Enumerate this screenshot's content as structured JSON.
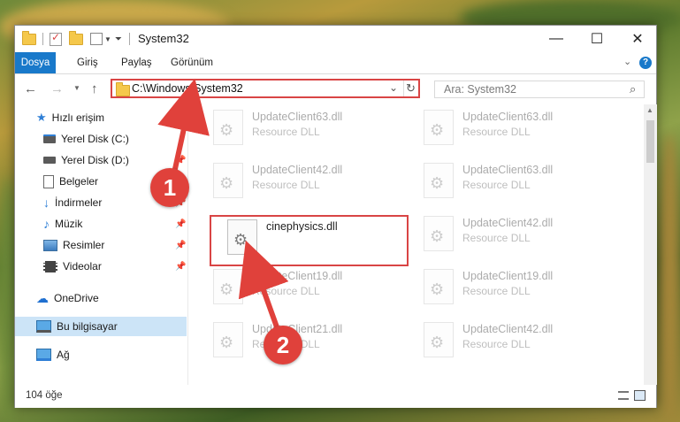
{
  "window": {
    "title": "System32",
    "controls": {
      "minimize": "—",
      "maximize": "☐",
      "close": "✕"
    }
  },
  "ribbon": {
    "tabs": [
      "Dosya",
      "Giriş",
      "Paylaş",
      "Görünüm"
    ],
    "active_tab": "Dosya"
  },
  "address": {
    "path": "C:\\Windows\\System32",
    "search_placeholder": "Ara: System32"
  },
  "nav": {
    "items": [
      {
        "label": "Hızlı erişim",
        "icon": "star-icon",
        "pinned": false
      },
      {
        "label": "Yerel Disk (C:)",
        "icon": "drive-icon",
        "pinned": false
      },
      {
        "label": "Yerel Disk (D:)",
        "icon": "drive-icon",
        "pinned": true
      },
      {
        "label": "Belgeler",
        "icon": "document-icon",
        "pinned": true
      },
      {
        "label": "İndirmeler",
        "icon": "download-icon",
        "pinned": true
      },
      {
        "label": "Müzik",
        "icon": "music-icon",
        "pinned": true
      },
      {
        "label": "Resimler",
        "icon": "pictures-icon",
        "pinned": true
      },
      {
        "label": "Videolar",
        "icon": "video-icon",
        "pinned": true
      },
      {
        "label": "OneDrive",
        "icon": "cloud-icon",
        "pinned": false
      },
      {
        "label": "Bu bilgisayar",
        "icon": "computer-icon",
        "pinned": false,
        "selected": true
      },
      {
        "label": "Ağ",
        "icon": "network-icon",
        "pinned": false
      }
    ]
  },
  "files": [
    {
      "name": "UpdateClient63.dll",
      "type": "Resource DLL"
    },
    {
      "name": "UpdateClient63.dll",
      "type": "Resource DLL"
    },
    {
      "name": "UpdateClient42.dll",
      "type": "Resource DLL"
    },
    {
      "name": "UpdateClient63.dll",
      "type": "Resource DLL"
    },
    {
      "name": "cinephysics.dll",
      "type": ""
    },
    {
      "name": "UpdateClient42.dll",
      "type": "Resource DLL"
    },
    {
      "name": "UpdateClient19.dll",
      "type": "Resource DLL"
    },
    {
      "name": "UpdateClient19.dll",
      "type": "Resource DLL"
    },
    {
      "name": "UpdateClient21.dll",
      "type": "Resource DLL"
    },
    {
      "name": "UpdateClient42.dll",
      "type": "Resource DLL"
    }
  ],
  "status": {
    "item_count": "104 öğe"
  },
  "annotations": {
    "badge1": "1",
    "badge2": "2",
    "color": "#e0413b"
  }
}
